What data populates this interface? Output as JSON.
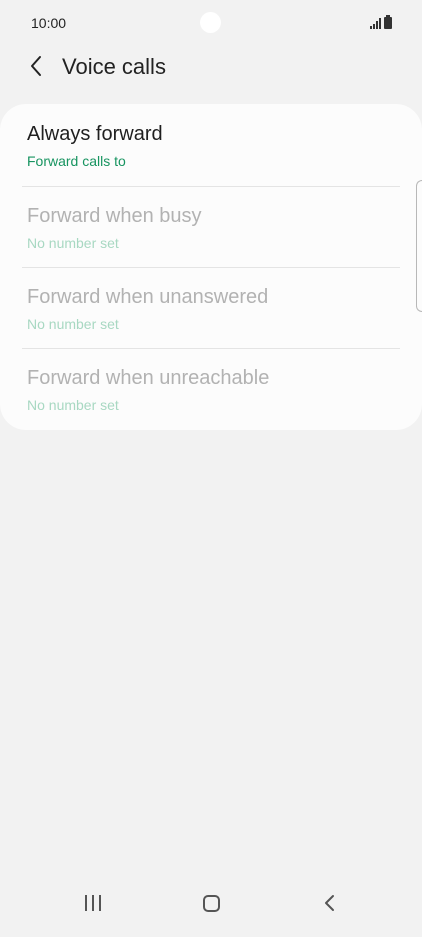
{
  "status_bar": {
    "time": "10:00",
    "icons": [
      "signal-icon",
      "battery-icon"
    ]
  },
  "header": {
    "title": "Voice calls",
    "back_icon": "chevron-left-icon"
  },
  "list": {
    "items": [
      {
        "title": "Always forward",
        "subtitle": "Forward calls to",
        "enabled": true
      },
      {
        "title": "Forward when busy",
        "subtitle": "No number set",
        "enabled": false
      },
      {
        "title": "Forward when unanswered",
        "subtitle": "No number set",
        "enabled": false
      },
      {
        "title": "Forward when unreachable",
        "subtitle": "No number set",
        "enabled": false
      }
    ]
  },
  "nav_bar": {
    "buttons": [
      "recents-icon",
      "home-icon",
      "back-icon"
    ]
  },
  "colors": {
    "background": "#f2f2f2",
    "card": "#fcfcfc",
    "accent_green": "#179460",
    "disabled_text": "#b2b2b2",
    "disabled_subtitle": "#a8d8c2"
  }
}
